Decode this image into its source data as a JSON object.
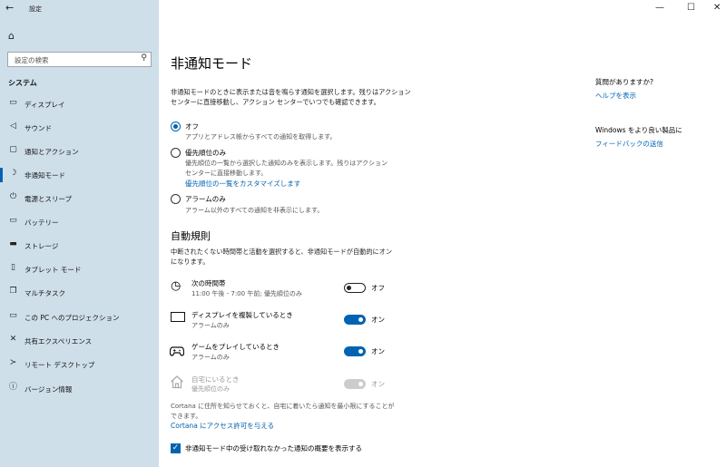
{
  "window": {
    "back_glyph": "←",
    "title": "設定",
    "min_glyph": "—",
    "max_glyph": "☐",
    "close_glyph": "✕"
  },
  "sidebar": {
    "home_glyph": "⌂",
    "search_placeholder": "設定の検索",
    "search_glyph": "⚲",
    "section": "システム",
    "items": [
      {
        "label": "ディスプレイ",
        "icon": "display-icon",
        "glyph": "▭"
      },
      {
        "label": "サウンド",
        "icon": "speaker-icon",
        "glyph": "◁"
      },
      {
        "label": "通知とアクション",
        "icon": "notification-icon",
        "glyph": "▢"
      },
      {
        "label": "非通知モード",
        "icon": "moon-icon",
        "glyph": "☽"
      },
      {
        "label": "電源とスリープ",
        "icon": "power-icon",
        "glyph": "⏻"
      },
      {
        "label": "バッテリー",
        "icon": "battery-icon",
        "glyph": "▭"
      },
      {
        "label": "ストレージ",
        "icon": "storage-icon",
        "glyph": "▬"
      },
      {
        "label": "タブレット モード",
        "icon": "tablet-icon",
        "glyph": "▯"
      },
      {
        "label": "マルチタスク",
        "icon": "multitask-icon",
        "glyph": "❐"
      },
      {
        "label": "この PC へのプロジェクション",
        "icon": "projection-icon",
        "glyph": "▭"
      },
      {
        "label": "共有エクスペリエンス",
        "icon": "shared-icon",
        "glyph": "✕"
      },
      {
        "label": "リモート デスクトップ",
        "icon": "remote-icon",
        "glyph": "≻"
      },
      {
        "label": "バージョン情報",
        "icon": "info-icon",
        "glyph": "ⓘ"
      }
    ]
  },
  "main": {
    "title": "非通知モード",
    "desc_line1": "非通知モードのときに表示または音を鳴らす通知を選択します。残りはアクション",
    "desc_line2": "センターに直接移動し、アクション センターでいつでも確認できます。",
    "options": [
      {
        "label": "オフ",
        "sub": [
          "アプリとアドレス帳からすべての通知を取得します。"
        ],
        "selected": true
      },
      {
        "label": "優先順位のみ",
        "sub": [
          "優先順位の一覧から選択した通知のみを表示します。残りはアクション",
          "センターに直接移動します。"
        ],
        "link": "優先順位の一覧をカスタマイズします",
        "selected": false
      },
      {
        "label": "アラームのみ",
        "sub": [
          "アラーム以外のすべての通知を非表示にします。"
        ],
        "selected": false
      }
    ],
    "auto_title": "自動規則",
    "auto_desc1": "中断されたくない時間帯と活動を選択すると、非通知モードが自動的にオン",
    "auto_desc2": "になります。",
    "rules": [
      {
        "label": "次の時間帯",
        "sub": "11:00 午後 - 7:00 午前; 優先順位のみ",
        "state": "オフ",
        "icon": "clock-icon",
        "glyph": "◷"
      },
      {
        "label": "ディスプレイを複製しているとき",
        "sub": "アラームのみ",
        "state": "オン",
        "icon": "monitor-icon",
        "glyph": "▭"
      },
      {
        "label": "ゲームをプレイしているとき",
        "sub": "アラームのみ",
        "state": "オン",
        "icon": "gamepad-icon",
        "glyph": "🎮"
      },
      {
        "label": "自宅にいるとき",
        "sub": "優先順位のみ",
        "state": "オン",
        "icon": "home-icon",
        "glyph": "⌂"
      }
    ],
    "cortana_line1": "Cortana に住所を知らせておくと、自宅に着いたら通知を最小限にすることが",
    "cortana_line2": "できます。",
    "cortana_link": "Cortana にアクセス許可を与える",
    "checkbox_label": "非通知モード中の受け取れなかった通知の概要を表示する",
    "checkbox_glyph": "✓"
  },
  "right": {
    "q_title": "質問がありますか?",
    "q_link": "ヘルプを表示",
    "fb_title": "Windows をより良い製品に",
    "fb_link": "フィードバックの送信"
  },
  "colors": {
    "accent": "#0063b1",
    "sidebar": "#cfdfea"
  }
}
